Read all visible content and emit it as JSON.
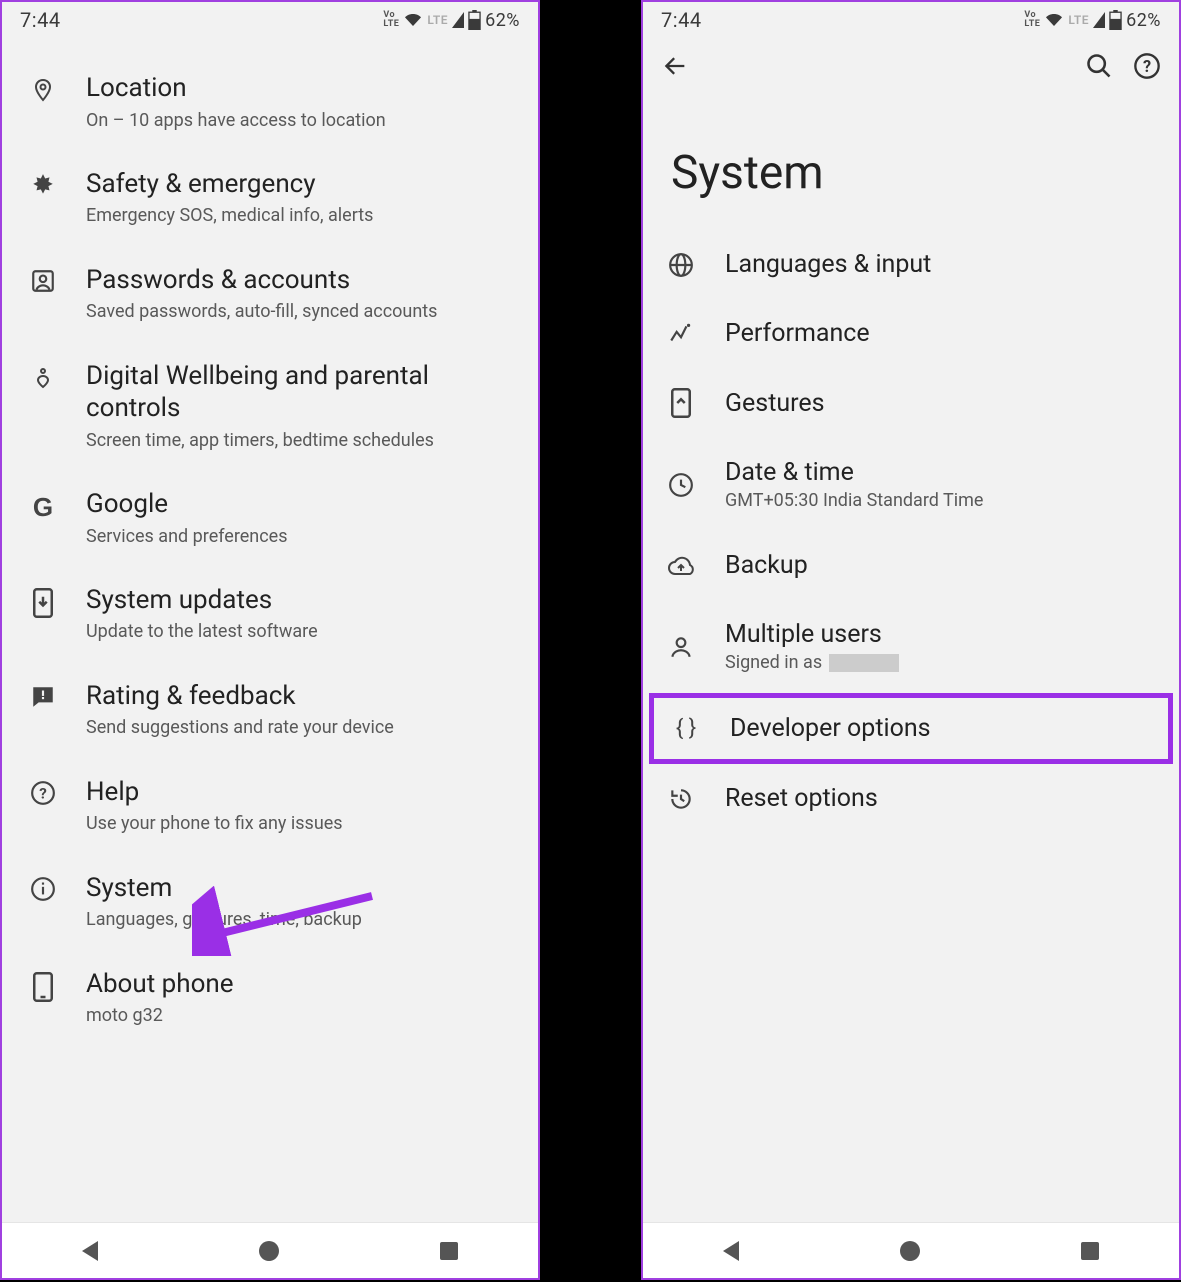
{
  "status": {
    "time": "7:44",
    "volte": "Vo\nLTE",
    "lte": "LTE",
    "battery": "62%"
  },
  "left": {
    "items": [
      {
        "key": "location",
        "title": "Location",
        "subtitle": "On – 10 apps have access to location"
      },
      {
        "key": "safety",
        "title": "Safety & emergency",
        "subtitle": "Emergency SOS, medical info, alerts"
      },
      {
        "key": "passwords",
        "title": "Passwords & accounts",
        "subtitle": "Saved passwords, auto-fill, synced accounts"
      },
      {
        "key": "wellbeing",
        "title": "Digital Wellbeing and parental controls",
        "subtitle": "Screen time, app timers, bedtime schedules"
      },
      {
        "key": "google",
        "title": "Google",
        "subtitle": "Services and preferences"
      },
      {
        "key": "updates",
        "title": "System updates",
        "subtitle": "Update to the latest software"
      },
      {
        "key": "rating",
        "title": "Rating & feedback",
        "subtitle": "Send suggestions and rate your device"
      },
      {
        "key": "help",
        "title": "Help",
        "subtitle": "Use your phone to fix any issues"
      },
      {
        "key": "system",
        "title": "System",
        "subtitle": "Languages, gestures, time, backup"
      },
      {
        "key": "about",
        "title": "About phone",
        "subtitle": "moto g32"
      }
    ]
  },
  "right": {
    "page_title": "System",
    "items": [
      {
        "key": "languages",
        "title": "Languages & input",
        "subtitle": ""
      },
      {
        "key": "performance",
        "title": "Performance",
        "subtitle": ""
      },
      {
        "key": "gestures",
        "title": "Gestures",
        "subtitle": ""
      },
      {
        "key": "datetime",
        "title": "Date & time",
        "subtitle": "GMT+05:30 India Standard Time"
      },
      {
        "key": "backup",
        "title": "Backup",
        "subtitle": ""
      },
      {
        "key": "users",
        "title": "Multiple users",
        "subtitle": "Signed in as "
      },
      {
        "key": "devopts",
        "title": "Developer options",
        "subtitle": ""
      },
      {
        "key": "reset",
        "title": "Reset options",
        "subtitle": ""
      }
    ]
  }
}
